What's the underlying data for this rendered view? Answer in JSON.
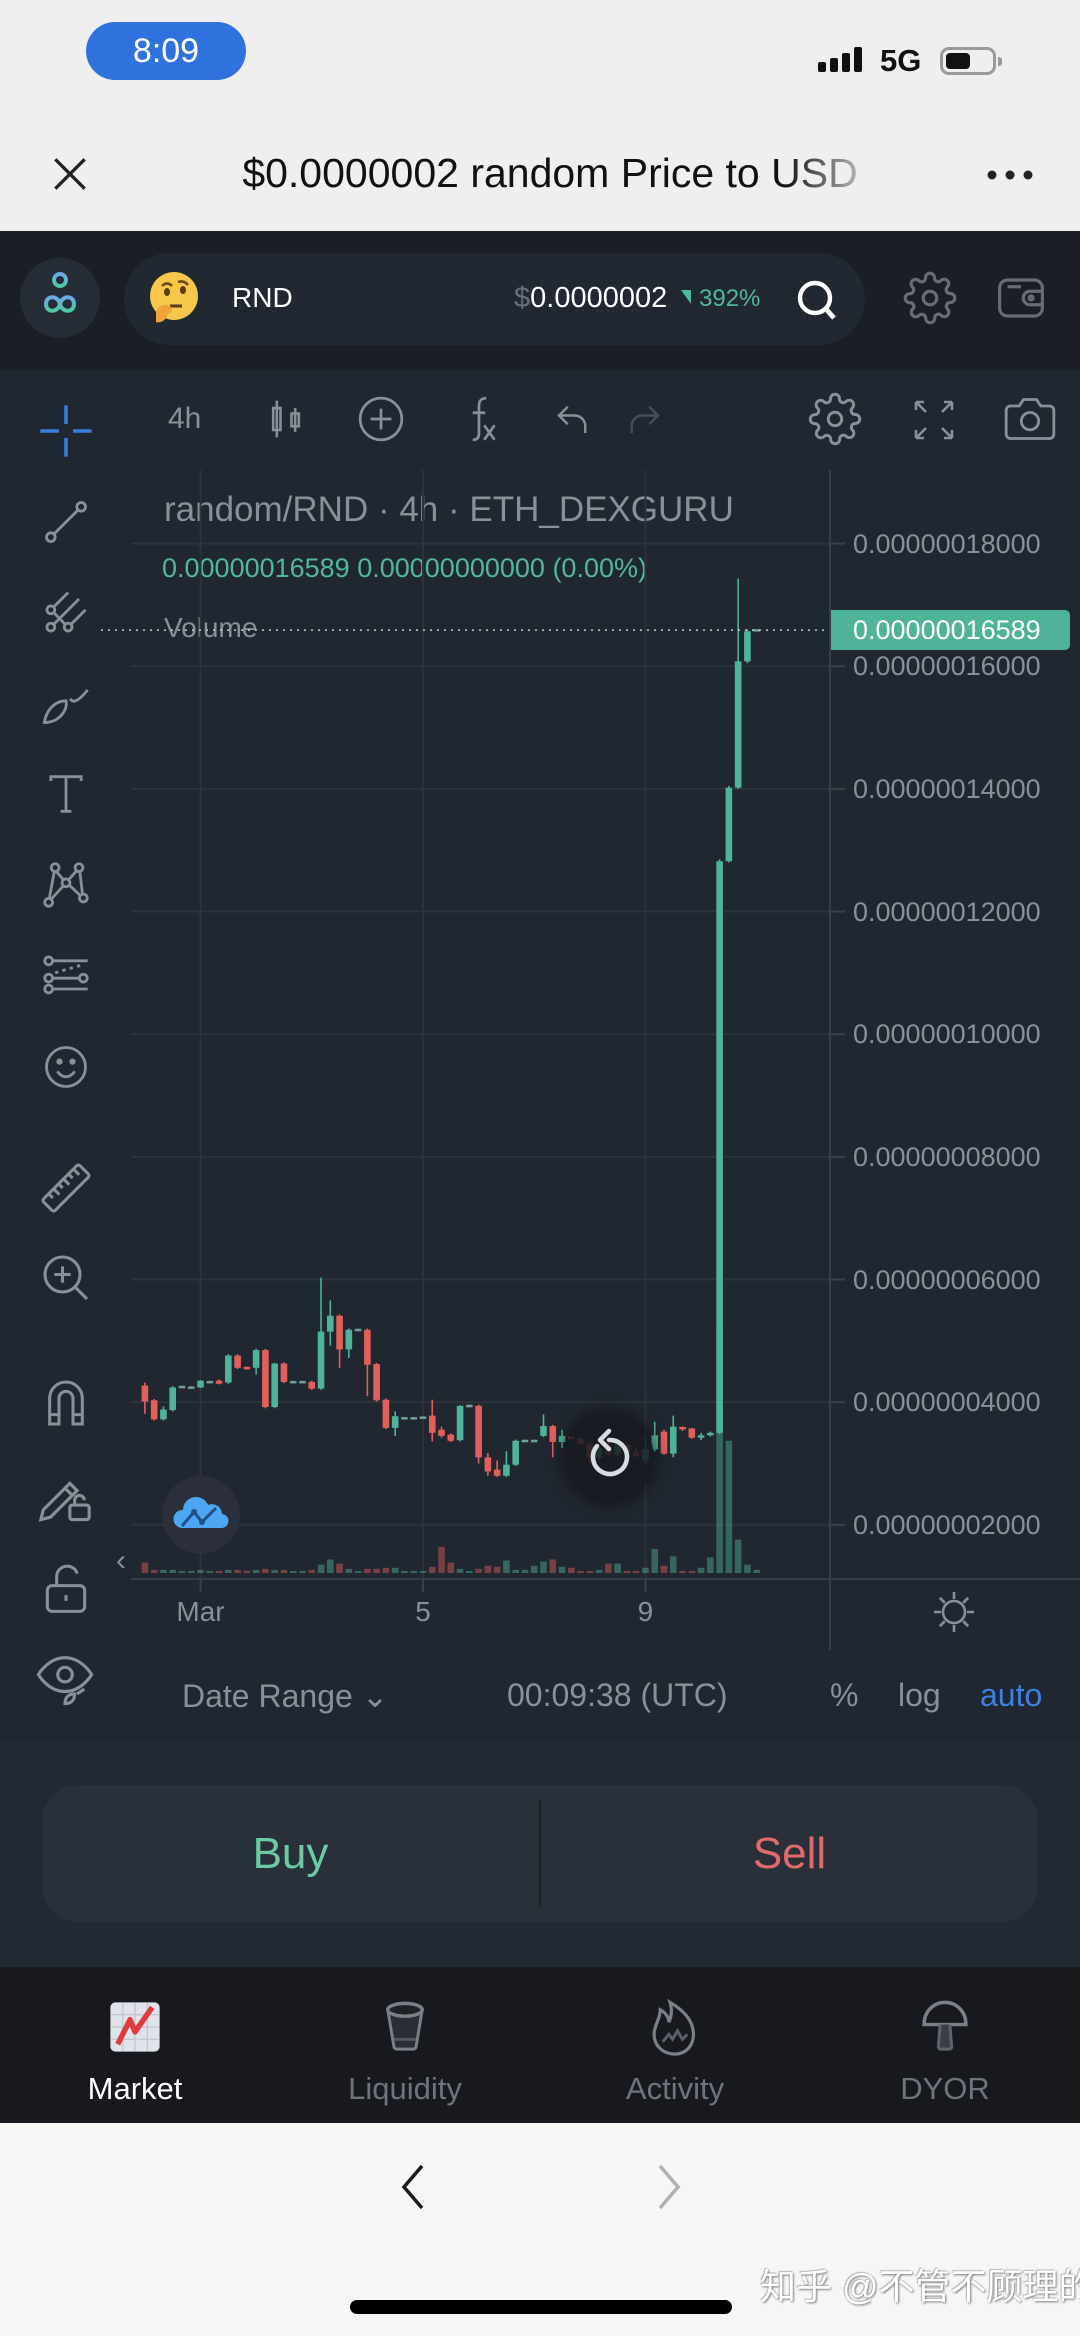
{
  "status_bar": {
    "time": "8:09",
    "network": "5G"
  },
  "browser": {
    "title": "$0.0000002 random Price to USD",
    "back_label": "‹",
    "forward_label": "›"
  },
  "header": {
    "token_symbol": "RND",
    "price_currency": "$",
    "price": "0.0000002",
    "change": "392%",
    "change_direction": "up"
  },
  "chart_toolbar": {
    "interval": "4h",
    "icons": [
      "candles-icon",
      "add-indicator-icon",
      "fx-icon",
      "undo-icon",
      "redo-icon",
      "gear-icon",
      "fullscreen-icon",
      "camera-icon"
    ]
  },
  "left_toolbar": {
    "icons": [
      "crosshair-icon",
      "trend-line-icon",
      "pitchfork-icon",
      "brush-icon",
      "text-icon",
      "pattern-icon",
      "fib-icon",
      "emoji-icon",
      "ruler-icon",
      "zoom-in-icon",
      "magnet-icon",
      "lock-drawings-icon",
      "lock-icon",
      "eye-icon"
    ]
  },
  "legend": {
    "title": "random/RND · 4h · ETH_DEXGURU",
    "last_price": "0.00000016589",
    "change": "0.00000000000",
    "change_pct": "(0.00%)",
    "volume_label": "Volume"
  },
  "price_axis": {
    "labels": [
      "0.00000018000",
      "0.00000016000",
      "0.00000014000",
      "0.00000012000",
      "0.00000010000",
      "0.00000008000",
      "0.00000006000",
      "0.00000004000",
      "0.00000002000"
    ],
    "current_price": "0.00000016589"
  },
  "scroll_left_label": "‹",
  "bottom_controls": {
    "date_range": "Date Range ⌄",
    "time": "00:09:38 (UTC)",
    "percent": "%",
    "log": "log",
    "auto": "auto"
  },
  "trade": {
    "buy": "Buy",
    "sell": "Sell"
  },
  "nav": {
    "items": [
      {
        "label": "Market",
        "icon": "market-chart-icon",
        "active": true
      },
      {
        "label": "Liquidity",
        "icon": "bucket-icon",
        "active": false
      },
      {
        "label": "Activity",
        "icon": "flame-icon",
        "active": false
      },
      {
        "label": "DYOR",
        "icon": "mushroom-icon",
        "active": false
      }
    ]
  },
  "watermark": "知乎 @不管不顾理的员",
  "colors": {
    "accent_blue": "#3d80e2",
    "up": "#4fb39a",
    "down": "#e2605b",
    "buy": "#6ccba4",
    "sell": "#e26a6c",
    "chart_bg": "#212730"
  },
  "chart_data": {
    "type": "candlestick",
    "title": "random/RND · 4h · ETH_DEXGURU",
    "value_unit_multiplier": 1e-08,
    "ylim": [
      1.1,
      19.2
    ],
    "xlim": [
      -1.5,
      73.8
    ],
    "y_ticks": [
      18,
      16,
      14,
      12,
      10,
      8,
      6,
      4,
      2
    ],
    "x_ticks": [
      {
        "label": "Mar",
        "index": 6
      },
      {
        "label": "5",
        "index": 30
      },
      {
        "label": "9",
        "index": 54
      }
    ],
    "last_price": 16.589,
    "ohlc_fields": [
      "open",
      "high",
      "low",
      "close"
    ],
    "ohlc": [
      [
        4.27,
        4.32,
        3.81,
        4.01
      ],
      [
        4.03,
        4.05,
        3.7,
        3.72
      ],
      [
        3.72,
        3.93,
        3.7,
        3.88
      ],
      [
        3.87,
        4.26,
        3.85,
        4.24
      ],
      [
        4.25,
        4.27,
        4.23,
        4.25
      ],
      [
        4.24,
        4.26,
        4.22,
        4.24
      ],
      [
        4.24,
        4.36,
        4.23,
        4.35
      ],
      [
        4.33,
        4.35,
        4.31,
        4.33
      ],
      [
        4.35,
        4.37,
        4.29,
        4.3
      ],
      [
        4.32,
        4.78,
        4.3,
        4.76
      ],
      [
        4.76,
        4.78,
        4.54,
        4.56
      ],
      [
        4.56,
        4.58,
        4.53,
        4.55
      ],
      [
        4.56,
        4.87,
        4.45,
        4.85
      ],
      [
        4.85,
        4.87,
        3.9,
        3.92
      ],
      [
        3.92,
        4.64,
        3.9,
        4.63
      ],
      [
        4.63,
        4.65,
        4.31,
        4.33
      ],
      [
        4.33,
        4.35,
        4.31,
        4.33
      ],
      [
        4.33,
        4.35,
        4.31,
        4.33
      ],
      [
        4.33,
        4.35,
        4.2,
        4.22
      ],
      [
        4.22,
        6.03,
        4.2,
        5.15
      ],
      [
        5.15,
        5.66,
        4.92,
        5.41
      ],
      [
        5.41,
        5.43,
        4.56,
        4.86
      ],
      [
        4.86,
        5.2,
        4.72,
        5.18
      ],
      [
        5.18,
        5.2,
        5.16,
        5.18
      ],
      [
        5.18,
        5.2,
        4.1,
        4.61
      ],
      [
        4.62,
        4.64,
        4.01,
        4.03
      ],
      [
        4.04,
        4.06,
        3.56,
        3.58
      ],
      [
        3.58,
        3.85,
        3.45,
        3.77
      ],
      [
        3.74,
        3.76,
        3.72,
        3.74
      ],
      [
        3.74,
        3.76,
        3.72,
        3.74
      ],
      [
        3.75,
        3.77,
        3.73,
        3.75
      ],
      [
        3.78,
        4.04,
        3.36,
        3.5
      ],
      [
        3.55,
        3.6,
        3.42,
        3.45
      ],
      [
        3.47,
        3.49,
        3.35,
        3.37
      ],
      [
        3.38,
        3.95,
        3.36,
        3.94
      ],
      [
        3.94,
        3.96,
        3.92,
        3.94
      ],
      [
        3.94,
        3.96,
        3.0,
        3.1
      ],
      [
        3.1,
        3.17,
        2.8,
        2.87
      ],
      [
        2.9,
        3.05,
        2.78,
        2.8
      ],
      [
        2.8,
        3.2,
        2.78,
        2.98
      ],
      [
        2.98,
        3.39,
        2.96,
        3.37
      ],
      [
        3.37,
        3.39,
        3.35,
        3.37
      ],
      [
        3.37,
        3.39,
        3.35,
        3.37
      ],
      [
        3.45,
        3.8,
        3.43,
        3.61
      ],
      [
        3.61,
        3.63,
        3.1,
        3.35
      ],
      [
        3.35,
        3.55,
        3.25,
        3.45
      ],
      [
        3.42,
        3.44,
        3.38,
        3.4
      ],
      [
        3.4,
        3.42,
        3.3,
        3.32
      ],
      [
        3.32,
        3.35,
        3.0,
        3.1
      ],
      [
        3.1,
        3.3,
        3.05,
        3.25
      ],
      [
        3.3,
        3.35,
        3.1,
        3.15
      ],
      [
        3.15,
        3.4,
        3.12,
        3.35
      ],
      [
        3.3,
        3.32,
        3.15,
        3.2
      ],
      [
        3.18,
        3.25,
        3.1,
        3.12
      ],
      [
        3.05,
        3.47,
        3.0,
        3.23
      ],
      [
        3.23,
        3.68,
        3.2,
        3.46
      ],
      [
        3.52,
        3.55,
        3.14,
        3.16
      ],
      [
        3.16,
        3.78,
        3.1,
        3.6
      ],
      [
        3.58,
        3.6,
        3.53,
        3.55
      ],
      [
        3.57,
        3.58,
        3.4,
        3.42
      ],
      [
        3.42,
        3.5,
        3.38,
        3.46
      ],
      [
        3.46,
        3.52,
        3.44,
        3.5
      ],
      [
        3.5,
        12.85,
        3.48,
        12.82
      ],
      [
        12.82,
        14.05,
        12.8,
        14.02
      ],
      [
        14.02,
        17.43,
        14.0,
        16.08
      ],
      [
        16.08,
        16.6,
        16.05,
        16.57
      ],
      [
        16.589,
        16.589,
        16.589,
        16.589
      ]
    ],
    "volume_unit": "relative",
    "volume": [
      10,
      3,
      3,
      3,
      2,
      2,
      3,
      2,
      2,
      3,
      3,
      2,
      3,
      4,
      3,
      3,
      2,
      2,
      3,
      8,
      13,
      9,
      4,
      2,
      4,
      4,
      5,
      5,
      2,
      2,
      2,
      6,
      25,
      10,
      4,
      2,
      4,
      7,
      6,
      12,
      3,
      3,
      7,
      11,
      13,
      6,
      5,
      2,
      2,
      3,
      9,
      9,
      2,
      2,
      5,
      23,
      7,
      16,
      2,
      2,
      5,
      15,
      240,
      127,
      32,
      8,
      3
    ],
    "legend": [
      "Volume"
    ]
  }
}
